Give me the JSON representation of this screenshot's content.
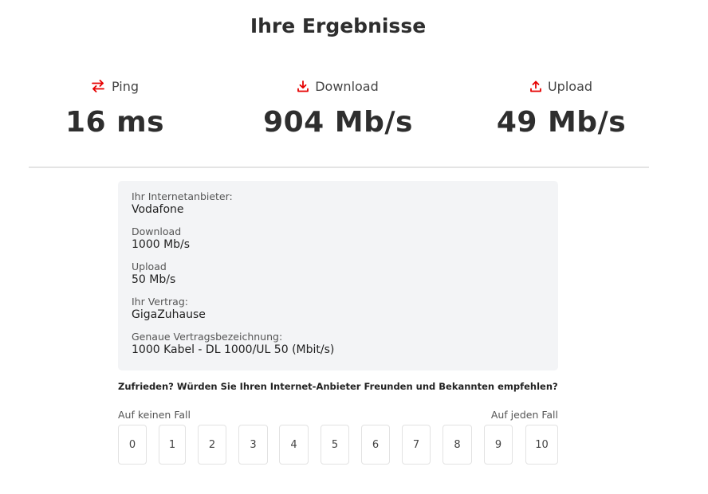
{
  "page_title": "Ihre Ergebnisse",
  "accent_color": "#e60000",
  "metrics": {
    "ping": {
      "label": "Ping",
      "value": "16 ms",
      "icon": "swap-arrows-icon"
    },
    "download": {
      "label": "Download",
      "value": "904 Mb/s",
      "icon": "download-icon"
    },
    "upload": {
      "label": "Upload",
      "value": "49 Mb/s",
      "icon": "upload-icon"
    }
  },
  "provider_info": {
    "provider": {
      "label": "Ihr Internetanbieter:",
      "value": "Vodafone"
    },
    "download": {
      "label": "Download",
      "value": "1000 Mb/s"
    },
    "upload": {
      "label": "Upload",
      "value": "50 Mb/s"
    },
    "contract": {
      "label": "Ihr Vertrag:",
      "value": "GigaZuhause"
    },
    "contract_name": {
      "label": "Genaue Vertragsbezeichnung:",
      "value": "1000 Kabel - DL 1000/UL 50 (Mbit/s)"
    }
  },
  "survey": {
    "question": "Zufrieden? Würden Sie Ihren Internet-Anbieter Freunden und Bekannten empfehlen?",
    "scale_min_label": "Auf keinen Fall",
    "scale_max_label": "Auf jeden Fall",
    "options": [
      "0",
      "1",
      "2",
      "3",
      "4",
      "5",
      "6",
      "7",
      "8",
      "9",
      "10"
    ]
  }
}
